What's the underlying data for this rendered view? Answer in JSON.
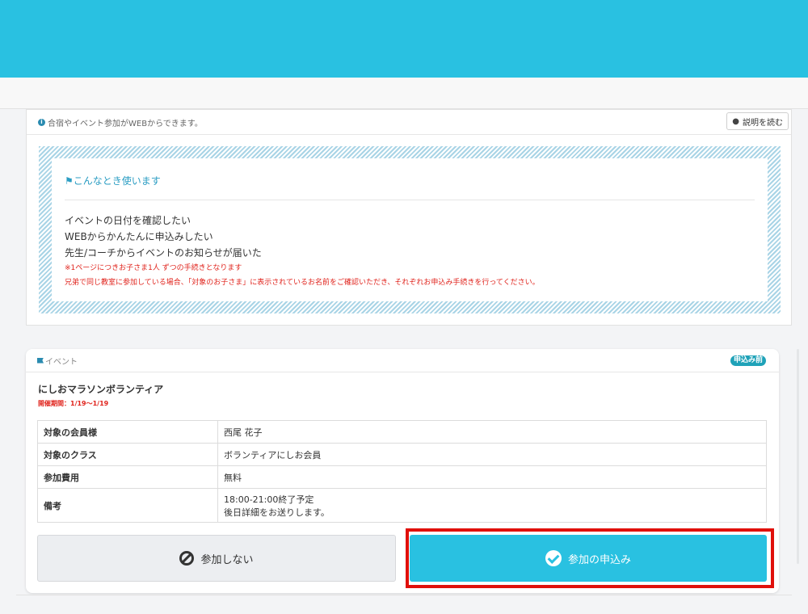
{
  "info": {
    "message": "合宿やイベント参加がWEBからできます。",
    "readme_label": "説明を読む",
    "uses_title": "こんなとき使います",
    "uses": [
      "イベントの日付を確認したい",
      "WEBからかんたんに申込みしたい",
      "先生/コーチからイベントのお知らせが届いた"
    ],
    "notes": [
      "※1ページにつきお子さま1人 ずつの手続きとなります",
      "兄弟で同じ教室に参加している場合、「対象のお子さま」に表示されているお名前をご確認いただき、それぞれお申込み手続きを行ってください。"
    ]
  },
  "event": {
    "section_label": "イベント",
    "status": "申込み前",
    "title": "にしおマラソンボランティア",
    "period": "開催期間：1/19〜1/19",
    "rows": [
      {
        "label": "対象の会員様",
        "value": "西尾 花子"
      },
      {
        "label": "対象のクラス",
        "value": "ボランティアにしお会員"
      },
      {
        "label": "参加費用",
        "value": "無料"
      },
      {
        "label": "備考",
        "value_line1": "18:00-21:00終了予定",
        "value_line2": "後日詳細をお送りします。"
      }
    ],
    "decline_label": "参加しない",
    "apply_label": "参加の申込み"
  },
  "colors": {
    "brand": "#29c1e1",
    "accent_text": "#2b9dc3",
    "warning": "#e0231c",
    "highlight_frame": "#e0100b"
  },
  "icons": {
    "info": "info-circle-icon",
    "readme": "comment-icon",
    "uses": "megaphone-icon",
    "section": "flag-icon",
    "decline": "ban-icon",
    "apply": "check-circle-icon"
  }
}
